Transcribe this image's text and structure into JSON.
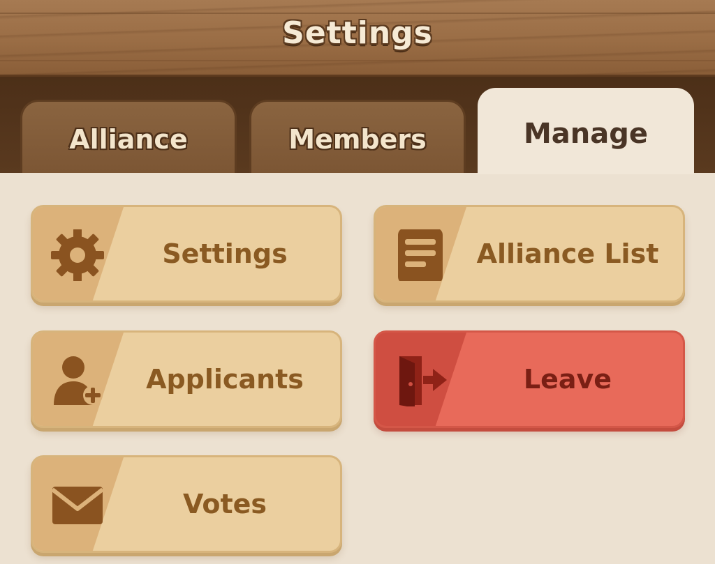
{
  "header": {
    "title": "Settings"
  },
  "tabs": [
    {
      "label": "Alliance",
      "active": false
    },
    {
      "label": "Members",
      "active": false
    },
    {
      "label": "Manage",
      "active": true
    }
  ],
  "menu": {
    "settings": {
      "label": "Settings",
      "icon": "gear-icon"
    },
    "alliance_list": {
      "label": "Alliance List",
      "icon": "document-list-icon"
    },
    "applicants": {
      "label": "Applicants",
      "icon": "add-user-icon"
    },
    "leave": {
      "label": "Leave",
      "icon": "exit-door-icon"
    },
    "votes": {
      "label": "Votes",
      "icon": "envelope-icon"
    }
  },
  "colors": {
    "wood": "#9a6d45",
    "panel_bg": "#ece1d1",
    "button_tan": "#ebcf9f",
    "button_red": "#e86a5a",
    "text_brown": "#8a5a22",
    "text_red": "#7a1f14"
  }
}
